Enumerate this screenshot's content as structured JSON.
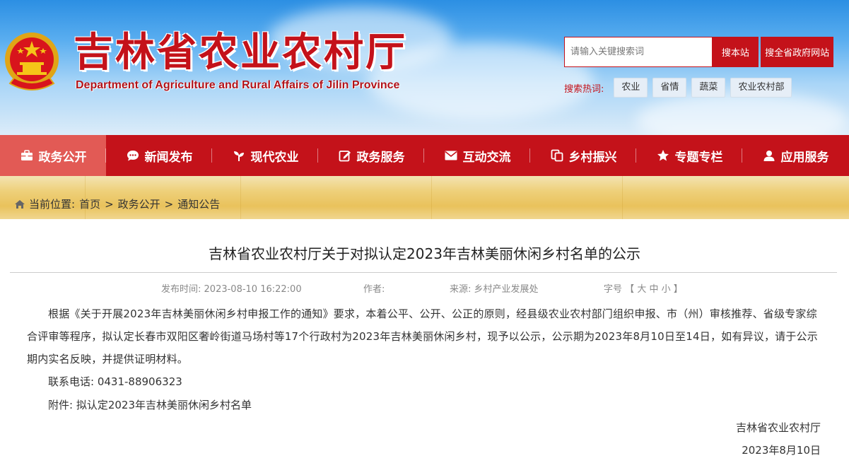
{
  "header": {
    "title": "吉林省农业农村厅",
    "subtitle": "Department of Agriculture and Rural Affairs of Jilin Province",
    "search": {
      "placeholder": "请输入关键搜索词",
      "site_button": "搜本站",
      "all_button": "搜全省政府网站"
    },
    "hot": {
      "label": "搜索热词:",
      "tags": [
        "农业",
        "省情",
        "蔬菜",
        "农业农村部"
      ]
    }
  },
  "nav": {
    "items": [
      {
        "label": "政务公开",
        "icon": "briefcase-icon"
      },
      {
        "label": "新闻发布",
        "icon": "chat-bubble-icon"
      },
      {
        "label": "现代农业",
        "icon": "sprout-icon"
      },
      {
        "label": "政务服务",
        "icon": "edit-icon"
      },
      {
        "label": "互动交流",
        "icon": "envelope-icon"
      },
      {
        "label": "乡村振兴",
        "icon": "copy-icon"
      },
      {
        "label": "专题专栏",
        "icon": "star-icon"
      },
      {
        "label": "应用服务",
        "icon": "user-icon"
      }
    ],
    "active_index": 0
  },
  "breadcrumb": {
    "label": "当前位置:",
    "items": [
      "首页",
      "政务公开",
      "通知公告"
    ],
    "separator": ">"
  },
  "article": {
    "title": "吉林省农业农村厅关于对拟认定2023年吉林美丽休闲乡村名单的公示",
    "meta": {
      "date_label": "发布时间:",
      "date": "2023-08-10 16:22:00",
      "author_label": "作者:",
      "author": "",
      "source_label": "来源:",
      "source": "乡村产业发展处",
      "fontsize_label": "字号",
      "bracket_open": "【",
      "size_large": "大",
      "size_medium": "中",
      "size_small": "小",
      "bracket_close": "】"
    },
    "body": "根据《关于开展2023年吉林美丽休闲乡村申报工作的通知》要求，本着公平、公开、公正的原则，经县级农业农村部门组织申报、市（州）审核推荐、省级专家综合评审等程序，拟认定长春市双阳区奢岭街道马场村等17个行政村为2023年吉林美丽休闲乡村，现予以公示，公示期为2023年8月10日至14日，如有异议，请于公示期内实名反映，并提供证明材料。",
    "contact_label": "联系电话:",
    "contact": "0431-88906323",
    "attachment_label": "附件:",
    "attachment": "拟认定2023年吉林美丽休闲乡村名单",
    "signature": "吉林省农业农村厅",
    "sign_date": "2023年8月10日"
  },
  "colors": {
    "brand_red": "#c4121a",
    "nav_active": "#e25a55",
    "sky_blue": "#2c8fe3"
  }
}
